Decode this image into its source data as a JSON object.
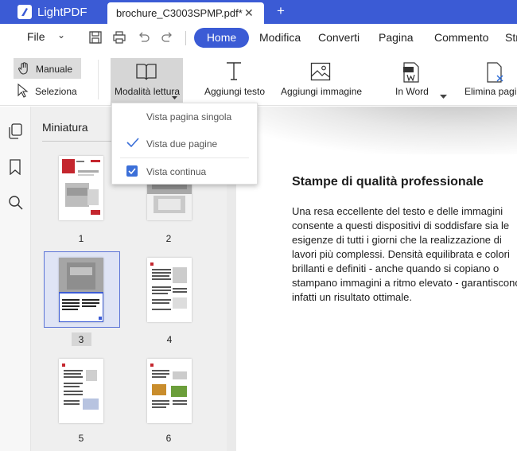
{
  "app": {
    "name": "LightPDF"
  },
  "tabs": {
    "active_title": "brochure_C3003SPMP.pdf*",
    "close": "✕",
    "new": "+"
  },
  "menu": {
    "file": "File",
    "file_chevron": "⌄",
    "tabs": [
      "Home",
      "Modifica",
      "Converti",
      "Pagina",
      "Commento",
      "Str"
    ]
  },
  "toolbar": {
    "manual": "Manuale",
    "select": "Seleziona",
    "reading_mode": "Modalità lettura",
    "add_text": "Aggiungi testo",
    "add_image": "Aggiungi immagine",
    "to_word": "In Word",
    "delete_page": "Elimina pagin"
  },
  "thumbnails": {
    "title": "Miniatura",
    "pages": [
      "1",
      "2",
      "3",
      "4",
      "5",
      "6"
    ],
    "selected_page": "3"
  },
  "reading_dropdown": {
    "options": [
      "Vista pagina singola",
      "Vista due pagine",
      "Vista continua"
    ],
    "checked": "Vista due pagine",
    "toggle_on": "Vista continua"
  },
  "document": {
    "heading": "Stampe di qualità professionale",
    "lines": [
      "Una resa eccellente del testo e delle immagini",
      "consente a questi dispositivi di soddisfare sia le",
      "esigenze di tutti i giorni che la realizzazione di",
      "lavori più complessi. Densità equilibrata e colori",
      "brillanti e definiti - anche quando si copiano o",
      "stampano immagini a ritmo elevato - garantiscono",
      "infatti un risultato ottimale."
    ]
  },
  "colors": {
    "accent": "#3b5bd5",
    "checkbox": "#3b6fd8",
    "selection": "#5b74d6"
  }
}
